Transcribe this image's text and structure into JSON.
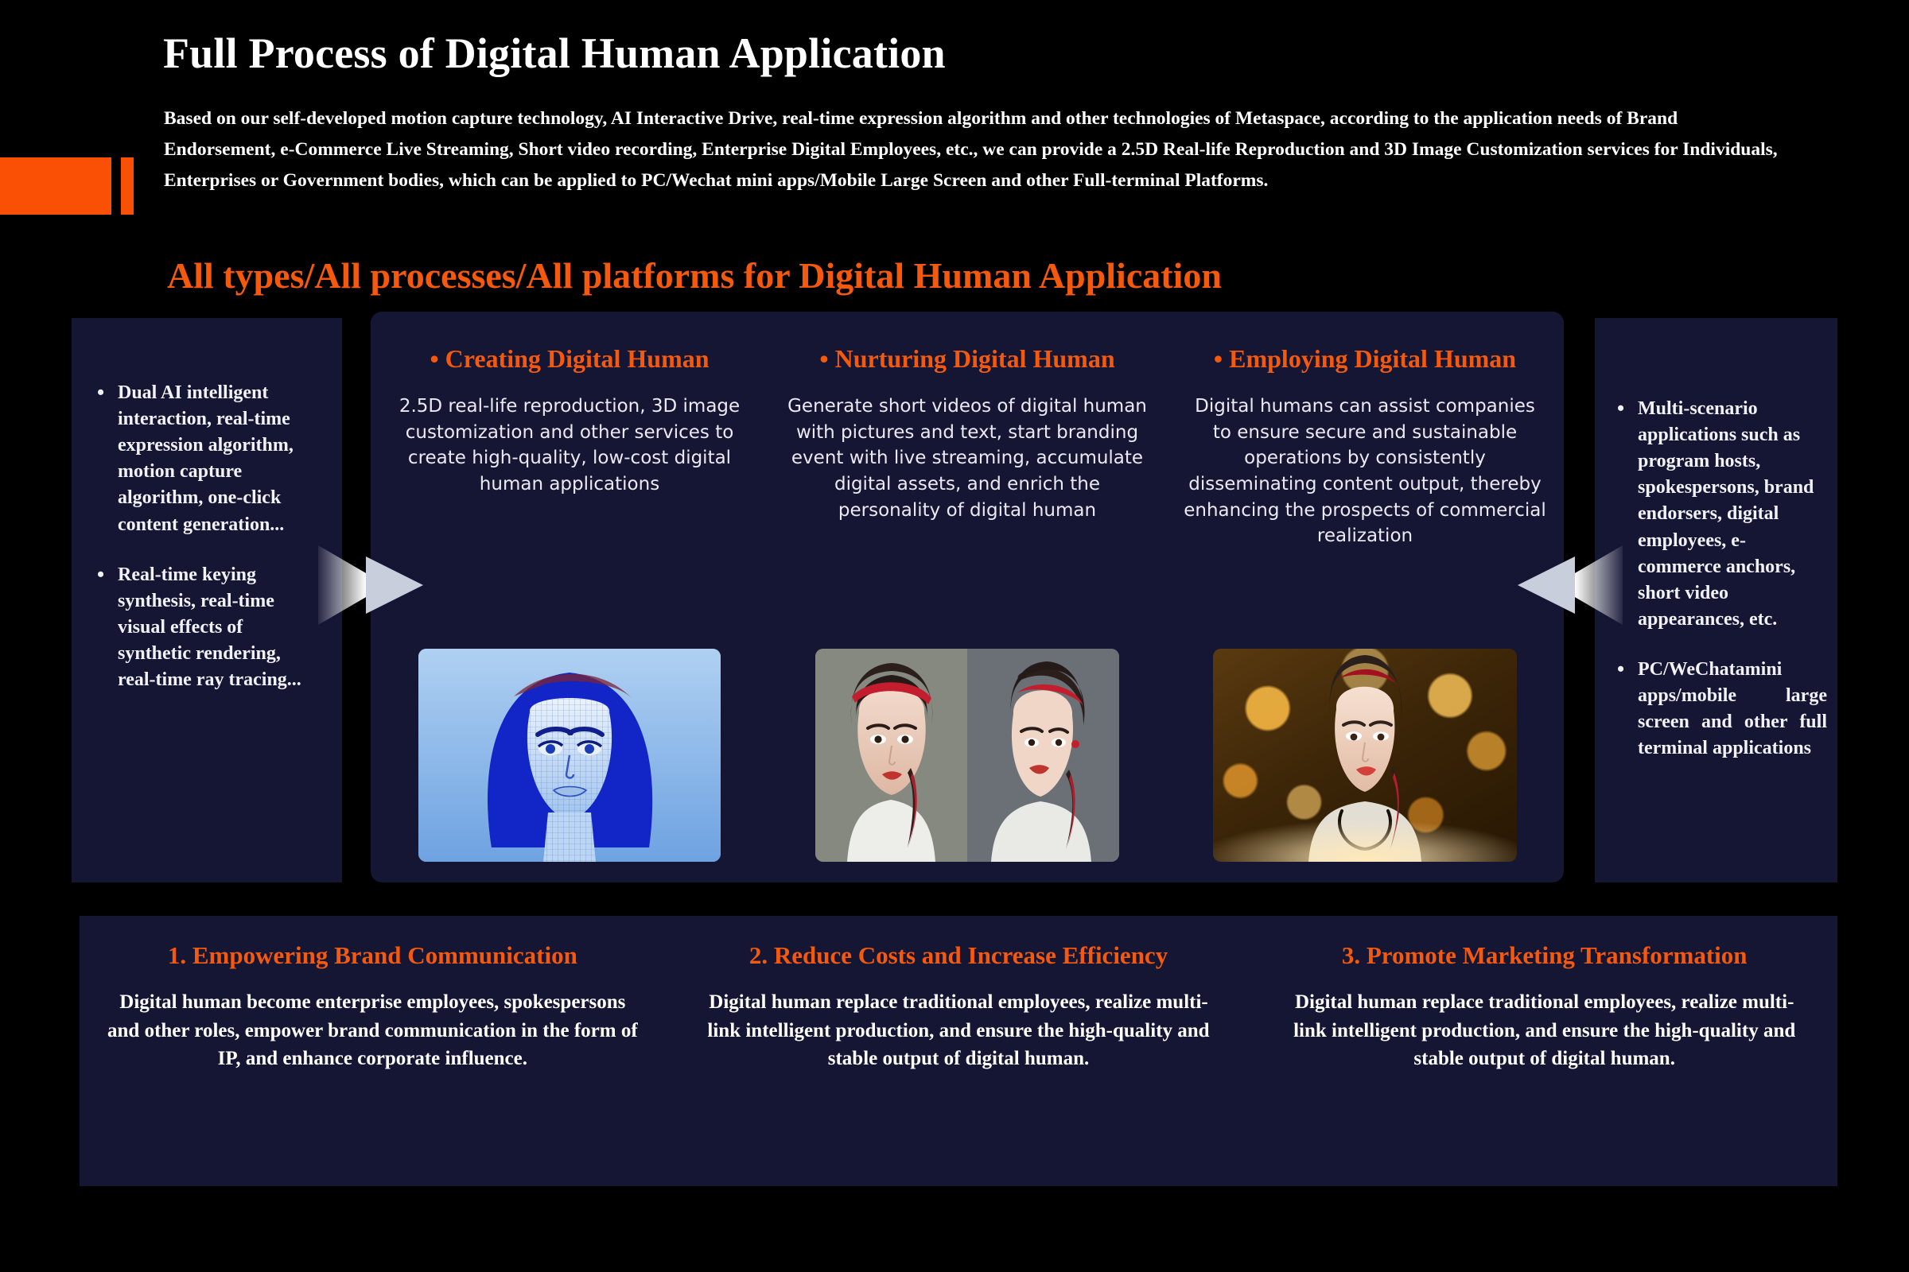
{
  "header": {
    "title": "Full Process of Digital Human Application",
    "intro": "Based on our self-developed motion capture technology, AI Interactive Drive, real-time expression algorithm and other technologies of Metaspace, according to the application needs of Brand Endorsement, e-Commerce Live Streaming, Short video recording, Enterprise Digital Employees, etc., we can provide a 2.5D Real-life Reproduction and 3D Image Customization services for Individuals, Enterprises or Government bodies, which can be applied to PC/Wechat mini apps/Mobile Large Screen and other Full-terminal Platforms.",
    "subtitle": "All types/All processes/All platforms for Digital Human Application",
    "accent_color": "#FA5005"
  },
  "left_panel": {
    "items": [
      "Dual AI intelligent interaction, real-time expression algorithm, motion capture algorithm, one-click content generation...",
      "Real-time keying synthesis, real-time visual effects of synthetic rendering, real-time ray tracing..."
    ]
  },
  "right_panel": {
    "items": [
      "Multi-scenario applications such as program hosts, spokespersons, brand endorsers, digital employees, e-commerce anchors, short video appearances, etc.",
      "PC/WeChatamini apps/mobile large screen and other full terminal applications"
    ]
  },
  "process_columns": [
    {
      "bullet": "•",
      "heading": "Creating Digital Human",
      "body": "2.5D real-life reproduction, 3D image customization and other services to create high-quality, low-cost digital human applications",
      "image_alt": "blue-3d-wireframe-digital-human-face"
    },
    {
      "bullet": "•",
      "heading": "Nurturing Digital Human",
      "body": "Generate short videos of digital human with pictures and text, start branding event with live streaming, accumulate digital assets, and enrich the personality of digital human",
      "image_alt": "two-realistic-digital-human-portraits-front-and-side"
    },
    {
      "bullet": "•",
      "heading": "Employing Digital Human",
      "body": "Digital humans can assist companies to ensure secure and sustainable operations by consistently disseminating content output, thereby enhancing the prospects of commercial realization",
      "image_alt": "digital-human-portrait-on-golden-bokeh-background"
    }
  ],
  "benefit_cards": [
    {
      "heading": "1. Empowering Brand Communication",
      "body": "Digital human become enterprise employees, spokespersons and other roles, empower brand communication in the form of IP, and enhance corporate influence."
    },
    {
      "heading": "2. Reduce Costs and Increase Efficiency",
      "body": "Digital human replace traditional employees, realize multi-link intelligent production, and ensure the high-quality and stable output of digital human."
    },
    {
      "heading": "3. Promote Marketing Transformation",
      "body": "Digital human replace traditional employees, realize multi-link intelligent production, and ensure the high-quality and stable output of digital human."
    }
  ],
  "colors": {
    "background": "#000000",
    "panel": "#141634",
    "accent_orange": "#F4590E",
    "text_white": "#FFFFFF"
  }
}
